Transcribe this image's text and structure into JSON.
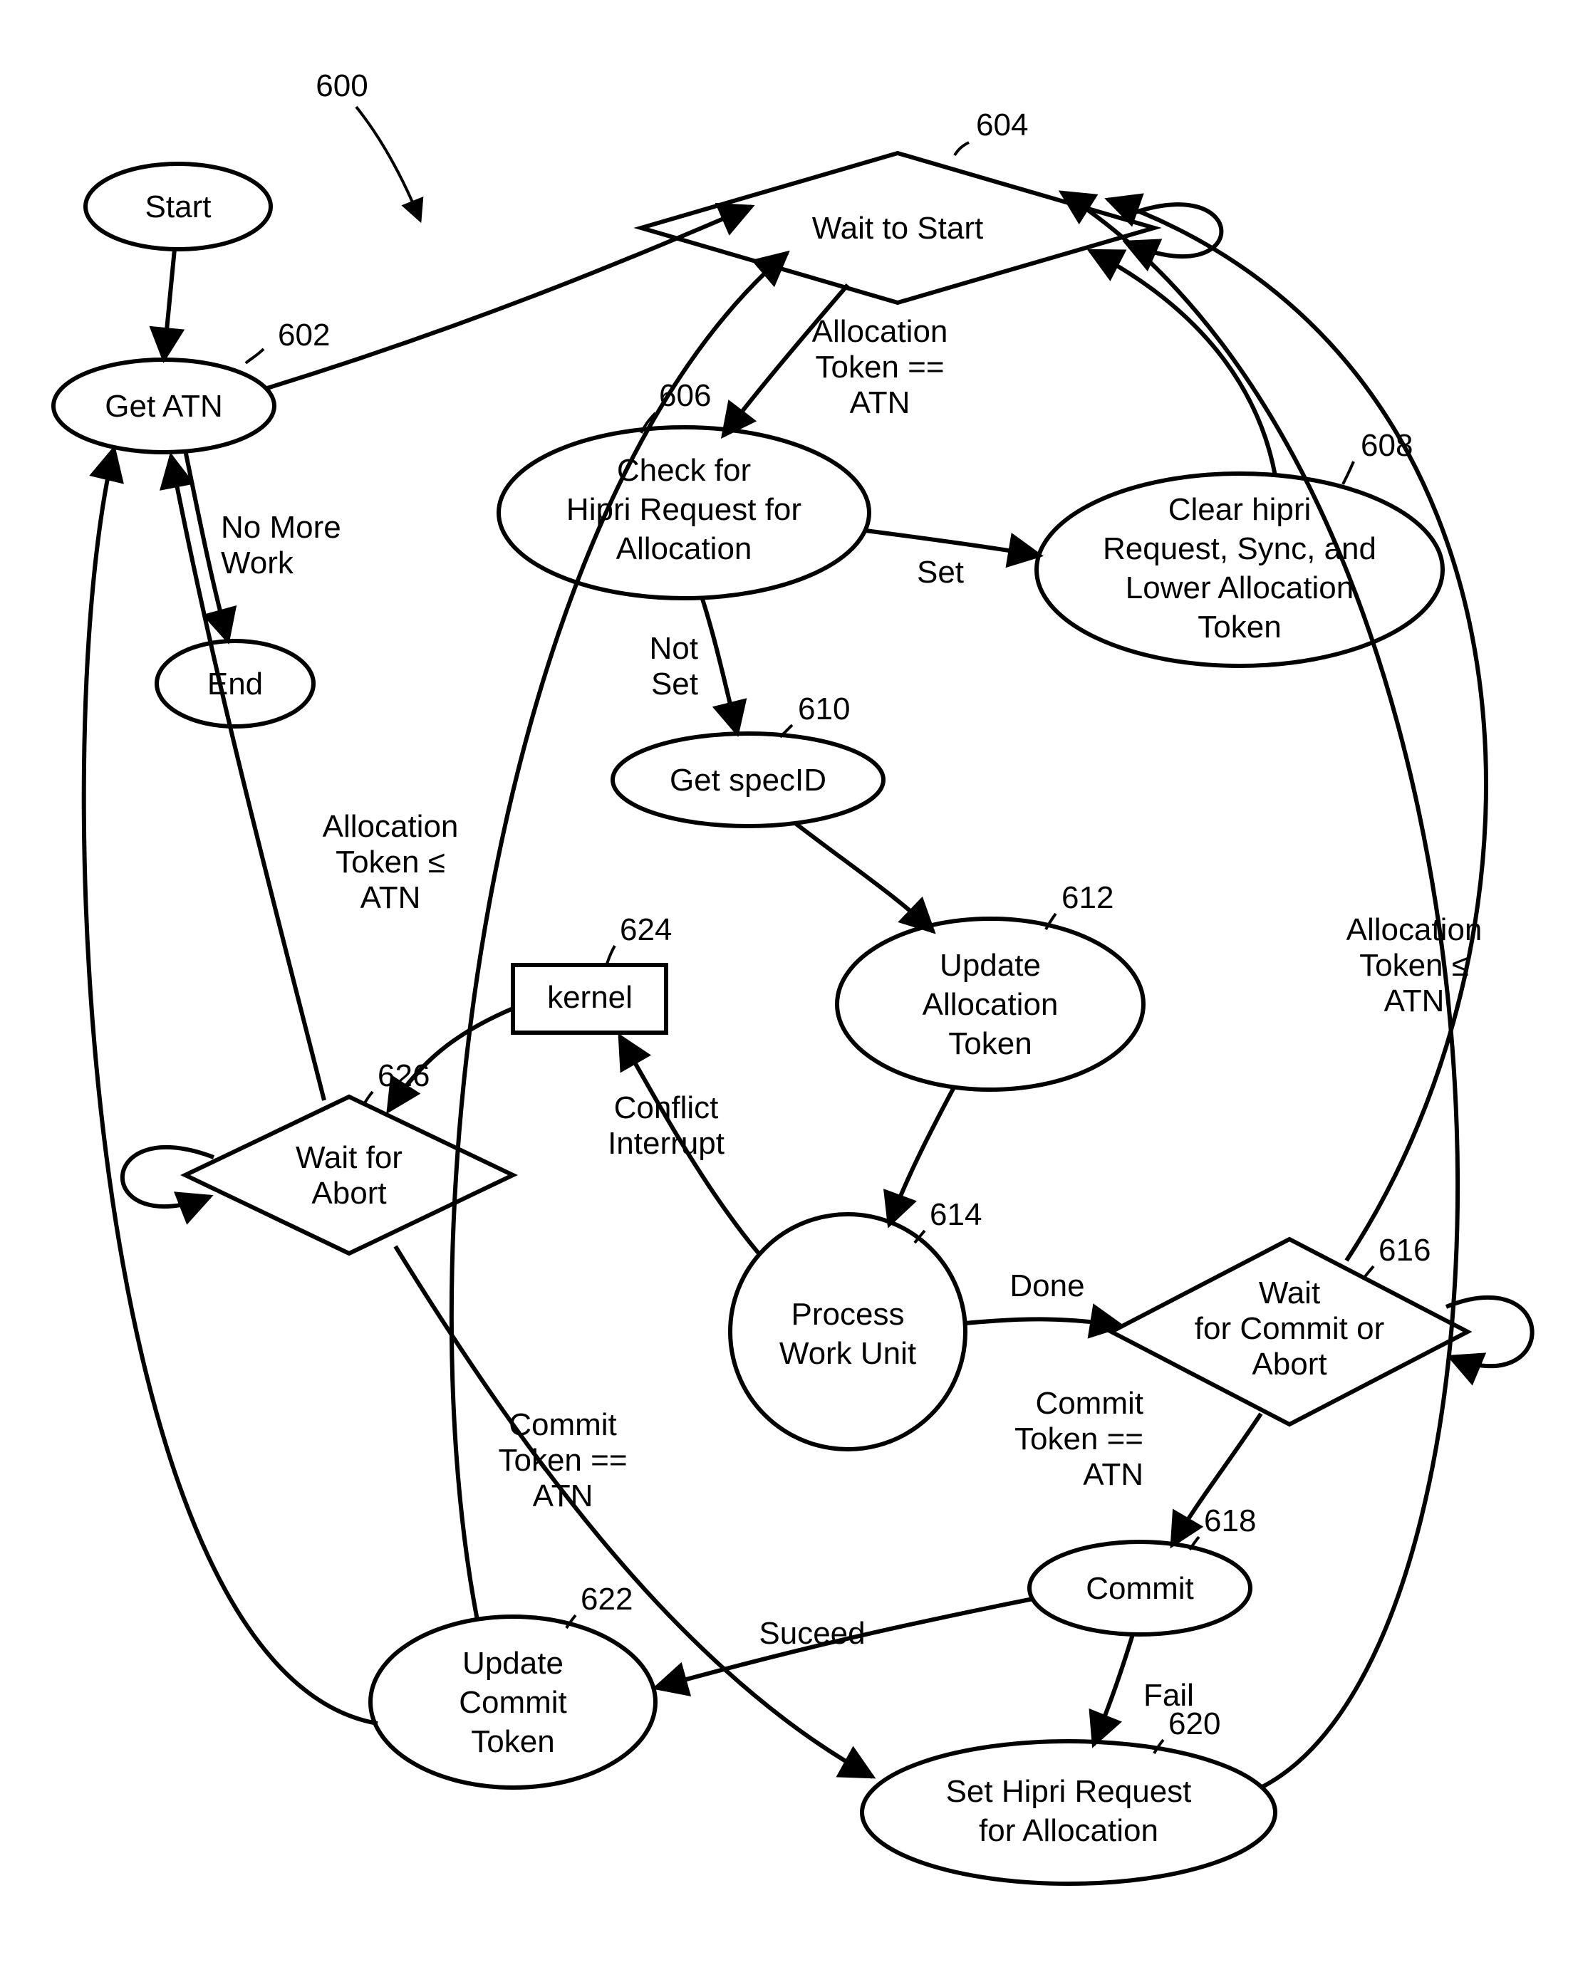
{
  "figure_ref": "600",
  "nodes": {
    "start": {
      "label": "Start"
    },
    "get_atn": {
      "label": "Get ATN",
      "ref": "602"
    },
    "end": {
      "label": "End"
    },
    "wait_start": {
      "label": "Wait to Start",
      "ref": "604"
    },
    "check_hipri": {
      "l1": "Check for",
      "l2": "Hipri Request for",
      "l3": "Allocation",
      "ref": "606"
    },
    "clear_hipri": {
      "l1": "Clear hipri",
      "l2": "Request, Sync, and",
      "l3": "Lower Allocation",
      "l4": "Token",
      "ref": "608"
    },
    "get_specid": {
      "label": "Get specID",
      "ref": "610"
    },
    "update_alloc": {
      "l1": "Update",
      "l2": "Allocation",
      "l3": "Token",
      "ref": "612"
    },
    "process_work": {
      "l1": "Process",
      "l2": "Work Unit",
      "ref": "614"
    },
    "wait_commit": {
      "l1": "Wait",
      "l2": "for Commit or",
      "l3": "Abort",
      "ref": "616"
    },
    "commit": {
      "label": "Commit",
      "ref": "618"
    },
    "set_hipri": {
      "l1": "Set Hipri Request",
      "l2": "for Allocation",
      "ref": "620"
    },
    "update_commit": {
      "l1": "Update",
      "l2": "Commit",
      "l3": "Token",
      "ref": "622"
    },
    "kernel": {
      "label": "kernel",
      "ref": "624"
    },
    "wait_abort": {
      "l1": "Wait for",
      "l2": "Abort",
      "ref": "626"
    }
  },
  "edge_labels": {
    "no_more_work": {
      "l1": "No More",
      "l2": "Work"
    },
    "alloc_eq_atn": {
      "l1": "Allocation",
      "l2": "Token ==",
      "l3": "ATN"
    },
    "set": "Set",
    "not_set": {
      "l1": "Not",
      "l2": "Set"
    },
    "alloc_le_atn_left": {
      "l1": "Allocation",
      "l2": "Token ≤",
      "l3": "ATN"
    },
    "alloc_le_atn_right": {
      "l1": "Allocation",
      "l2": "Token ≤",
      "l3": "ATN"
    },
    "conflict_interrupt": {
      "l1": "Conflict",
      "l2": "Interrupt"
    },
    "done": "Done",
    "commit_eq_atn_right": {
      "l1": "Commit",
      "l2": "Token ==",
      "l3": "ATN"
    },
    "commit_eq_atn_left": {
      "l1": "Commit",
      "l2": "Token ==",
      "l3": "ATN"
    },
    "succeed": "Suceed",
    "fail": "Fail"
  }
}
